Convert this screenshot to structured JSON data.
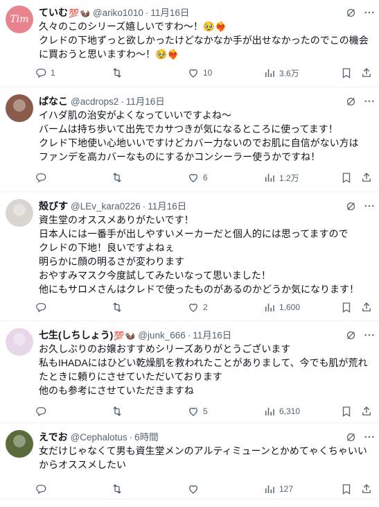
{
  "tweets": [
    {
      "name": "ていむ",
      "handle": "@ariko1010",
      "date": "11月16日",
      "body": [
        "久々のこのシリーズ嬉しいですわ〜！🥹❤️‍🔥",
        "クレドの下地ずっと欲しかったけどなかなか手が出せなかったのでこの機会",
        "に買おうと思いますわ〜！🥹❤️‍🔥"
      ],
      "replies": "1",
      "retweets": "",
      "likes": "10",
      "views": "3.6万",
      "avatar_text": "Tim",
      "avatar_color": "#e9848f"
    },
    {
      "name": "ぱなこ",
      "handle": "@acdrops2",
      "date": "11月16日",
      "body": [
        "イハダ肌の治安がよくなっていいですよね〜",
        "バームは持ち歩いて出先でカサつきが気になるところに使ってます！",
        "クレド下地使い心地いいですけどカバー力ないのでお肌に自信がない方は",
        "ファンデを高カバーなものにするかコンシーラー使うかですね！"
      ],
      "replies": "",
      "retweets": "",
      "likes": "6",
      "views": "1.2万",
      "avatar_text": "",
      "avatar_color": "#8a5a4a"
    },
    {
      "name": "殻びす",
      "handle": "@LEv_kara0226",
      "date": "11月16日",
      "body": [
        "資生堂のオススメありがたいです！",
        "日本人には一番手が出しやすいメーカーだと個人的には思ってますので",
        "クレドの下地！良いですよねぇ",
        "明らかに顔の明るさが変わります",
        "おやすみマスク今度試してみたいなって思いました！",
        "他にもサロメさんはクレドで使ったものがあるのかどうか気になります！"
      ],
      "replies": "",
      "retweets": "",
      "likes": "2",
      "views": "1,600",
      "avatar_text": "",
      "avatar_color": "#d9d6d2"
    },
    {
      "name": "七生(しちしょう)",
      "handle": "@junk_666",
      "date": "11月16日",
      "body": [
        "お久しぶりのお嬢おすすめシリーズありがとうございます",
        "私もIHADAにはひどい乾燥肌を救われたことがありまして、今でも肌が荒れ",
        "たときに頼りにさせていただいております",
        "他のも参考にさせていただきますね"
      ],
      "replies": "",
      "retweets": "",
      "likes": "5",
      "views": "6,310",
      "avatar_text": "",
      "avatar_color": "#e7d7e8"
    },
    {
      "name": "えでお",
      "handle": "@Cephalotus",
      "date": "6時間",
      "body": [
        "女だけじゃなくて男も資生堂メンのアルティミューンとかめてゃくちゃいい",
        "からオススメしたい"
      ],
      "replies": "",
      "retweets": "",
      "likes": "",
      "views": "127",
      "avatar_text": "",
      "avatar_color": "#5a6b3c"
    }
  ],
  "badges": {
    "hundred": "💯",
    "cup": "🦦"
  },
  "colors": {
    "text": "#0f1419",
    "muted": "#536471",
    "divider": "#eff3f4"
  },
  "icons": [
    "reply-icon",
    "retweet-icon",
    "like-icon",
    "views-icon",
    "bookmark-icon",
    "share-icon",
    "grok-icon"
  ]
}
